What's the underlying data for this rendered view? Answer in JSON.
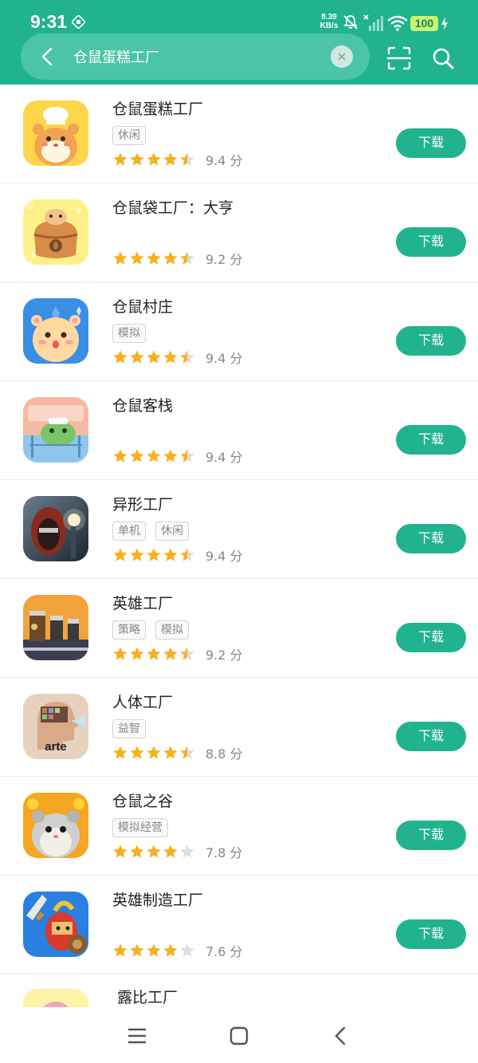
{
  "status_bar": {
    "time": "9:31",
    "net_speed_value": "8.39",
    "net_speed_unit": "KB/s",
    "battery": "100",
    "icons": [
      "sim-icon",
      "mute-icon",
      "signal-icon",
      "wifi-icon",
      "bolt-icon"
    ]
  },
  "search": {
    "query": "仓鼠蛋糕工厂",
    "icons": [
      "back-icon",
      "clear-icon",
      "scan-icon",
      "search-icon"
    ]
  },
  "colors": {
    "accent": "#20b38e",
    "star_filled": "#f7b01e",
    "star_empty": "#dddddd"
  },
  "download_label": "下载",
  "apps": [
    {
      "name": "仓鼠蛋糕工厂",
      "tags": [
        "休闲"
      ],
      "stars": 4.5,
      "score": "9.4 分"
    },
    {
      "name": "仓鼠袋工厂：大亨",
      "tags": [],
      "stars": 4.5,
      "score": "9.2 分"
    },
    {
      "name": "仓鼠村庄",
      "tags": [
        "模拟"
      ],
      "stars": 4.5,
      "score": "9.4 分"
    },
    {
      "name": "仓鼠客栈",
      "tags": [],
      "stars": 4.5,
      "score": "9.4 分"
    },
    {
      "name": "异形工厂",
      "tags": [
        "单机",
        "休闲"
      ],
      "stars": 4.5,
      "score": "9.4 分"
    },
    {
      "name": "英雄工厂",
      "tags": [
        "策略",
        "模拟"
      ],
      "stars": 4.5,
      "score": "9.2 分"
    },
    {
      "name": "人体工厂",
      "tags": [
        "益智"
      ],
      "stars": 4.5,
      "score": "8.8 分",
      "icon_text": "arte"
    },
    {
      "name": "仓鼠之谷",
      "tags": [
        "模拟经营"
      ],
      "stars": 4,
      "score": "7.8 分"
    },
    {
      "name": "英雄制造工厂",
      "tags": [],
      "stars": 4,
      "score": "7.6 分"
    },
    {
      "name": "露比工厂",
      "tags": [],
      "stars": null,
      "score": ""
    }
  ],
  "nav_bar": {
    "icons": [
      "menu-icon",
      "home-icon",
      "back-nav-icon"
    ]
  }
}
